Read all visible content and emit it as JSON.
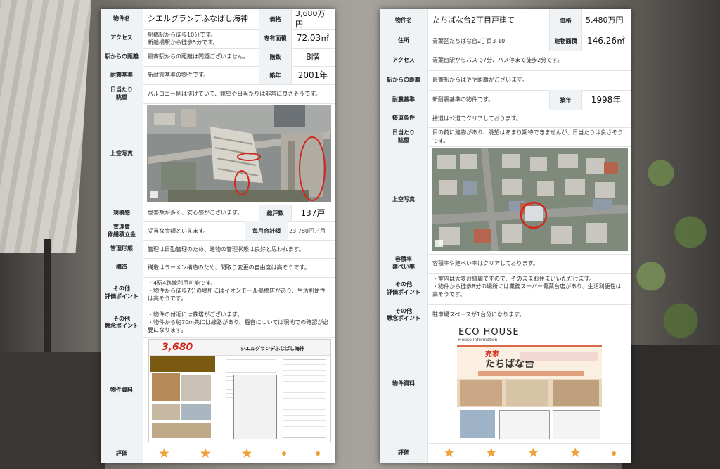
{
  "left": {
    "name_label": "物件名",
    "name": "シエルグランデふなばし海神",
    "price_label": "価格",
    "price": "3,680万円",
    "access_label": "アクセス",
    "access": [
      "船橋駅から徒歩10分です。",
      "新船橋駅から徒歩5分です。"
    ],
    "area_label": "専有面積",
    "area": "72.03㎡",
    "distance_label": "駅からの距離",
    "distance": "最寄駅からの距離は問題ございません。",
    "floor_label": "階数",
    "floor": "8階",
    "quake_label": "耐震基準",
    "quake": "新耐震基準の物件です。",
    "built_label": "築年",
    "built": "2001年",
    "sun_label": "日当たり\n眺望",
    "sun": "バルコニー側は抜けていて、眺望や日当たりは非常に良さそうです。",
    "aerial_label": "上空写真",
    "scale_label": "規模感",
    "scale": "世帯数が多く、安心感がございます。",
    "units_label": "総戸数",
    "units": "137戸",
    "fee_label": "管理費\n修繕積立金",
    "fee": "妥当な金額といえます。",
    "monthly_label": "毎月合計額",
    "monthly": "23,780円／月",
    "mgmt_label": "管理形態",
    "mgmt": "管理は日勤管理のため、建物の管理状態は良好と思われます。",
    "struct_label": "構造",
    "struct": "構造はラーメン構造のため、間取り変更の自由度は高そうです。",
    "point_label": "その他\n評価ポイント",
    "point": [
      "・4駅4路線利用可能です。",
      "・物件から徒歩7分の場所にはイオンモール船橋店があり、生活利便性は高そうです。"
    ],
    "concern_label": "その他\n懸念ポイント",
    "concern": [
      "・物件の付近には鉄塔がございます。",
      "・物件から約70m先には線路があり、騒音については現地での確認が必要になります。"
    ],
    "doc_label": "物件資料",
    "flyer_price": "3,680",
    "flyer_name": "シエルグランデふなばし海神",
    "rating_label": "評価",
    "rating_stars": 3,
    "rating_total": 5
  },
  "right": {
    "name_label": "物件名",
    "name": "たちばな台2丁目戸建て",
    "price_label": "価格",
    "price": "5,480万円",
    "addr_label": "住所",
    "addr": "青葉区たちばな台2丁目3-10",
    "area_label": "建物面積",
    "area": "146.26㎡",
    "access_label": "アクセス",
    "access": "青葉台駅からバスで7分、バス停まで徒歩2分です。",
    "distance_label": "駅からの距離",
    "distance": "最寄駅からはやや距離がございます。",
    "quake_label": "耐震基準",
    "quake": "新耐震基準の物件です。",
    "built_label": "築年",
    "built": "1998年",
    "road_label": "接道条件",
    "road": "接道は公道でクリアしております。",
    "sun_label": "日当たり\n眺望",
    "sun": "目の前に建物があり、眺望はあまり期待できませんが、日当たりは良さそうです。",
    "aerial_label": "上空写真",
    "ratio_label": "容積率\n建ぺい率",
    "ratio": "容積率や建ぺい率はクリアしております。",
    "point_label": "その他\n評価ポイント",
    "point": [
      "・室内は大変お綺麗ですので、そのままお住まいいただけます。",
      "・物件から徒歩8分の場所には業務スーパー青葉台店があり、生活利便性は高そうです。"
    ],
    "concern_label": "その他\n懸念ポイント",
    "concern": "駐車場スペースが1台分になります。",
    "doc_label": "物件資料",
    "eco_title": "ECO HOUSE",
    "eco_sub": "House Information",
    "eco_sale": "売家",
    "eco_town": "たちばな台",
    "rating_label": "評価",
    "rating_stars": 4,
    "rating_total": 5
  },
  "colors": {
    "label_bg": "#f0f3f6",
    "star": "#f0a23a",
    "circle": "#d0281c"
  }
}
